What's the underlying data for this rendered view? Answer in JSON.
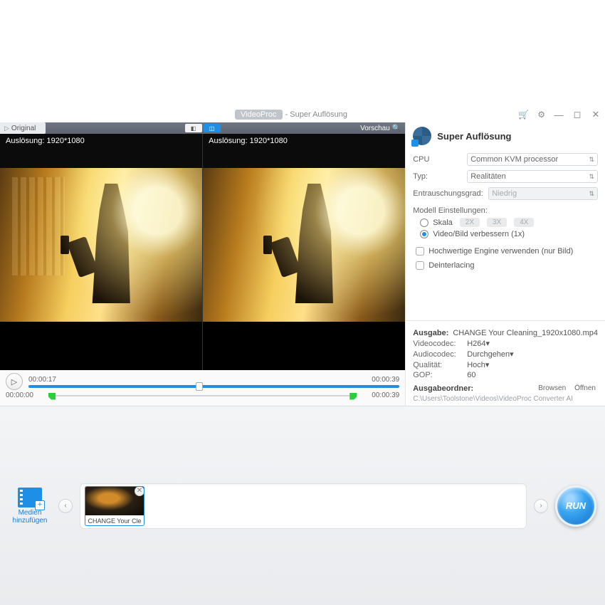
{
  "titlebar": {
    "app": "VideoProc",
    "subtitle": "- Super Auflösung"
  },
  "tabs": {
    "original": "Original",
    "vorschau": "Vorschau"
  },
  "preview": {
    "left_label_prefix": "Auslösung:",
    "left_res": "1920*1080",
    "right_label_prefix": "Auslösung:",
    "right_res": "1920*1080"
  },
  "transport": {
    "pos": "00:00:17",
    "dur": "00:00:39",
    "range_start": "00:00:00",
    "range_end": "00:00:39"
  },
  "side": {
    "title": "Super Auflösung",
    "cpu_label": "CPU",
    "cpu_value": "Common KVM processor",
    "typ_label": "Typ:",
    "typ_value": "Realitäten",
    "noise_label": "Entrauschungsgrad:",
    "noise_value": "Niedrig",
    "model_label": "Modell Einstellungen:",
    "opt_skala": "Skala",
    "scale_2x": "2X",
    "scale_3x": "3X",
    "scale_4x": "4X",
    "opt_enhance": "Video/Bild verbessern (1x)",
    "chk_hq": "Hochwertige Engine verwenden (nur Bild)",
    "chk_deint": "Deinterlacing"
  },
  "output": {
    "ausgabe_label": "Ausgabe:",
    "ausgabe_value": "CHANGE Your Cleaning_1920x1080.mp4",
    "vcodec_label": "Videocodec:",
    "vcodec_value": "H264",
    "acodec_label": "Audiocodec:",
    "acodec_value": "Durchgehen",
    "quality_label": "Qualität:",
    "quality_value": "Hoch",
    "gop_label": "GOP:",
    "gop_value": "60",
    "folder_label": "Ausgabeordner:",
    "browse": "Browsen",
    "open": "Öffnen",
    "folder_path": "C:\\Users\\Toolstone\\Videos\\VideoProc Converter AI"
  },
  "footer": {
    "add_media": "Medien hinzufügen",
    "thumb_label": "CHANGE Your Cle",
    "run": "RUN"
  }
}
